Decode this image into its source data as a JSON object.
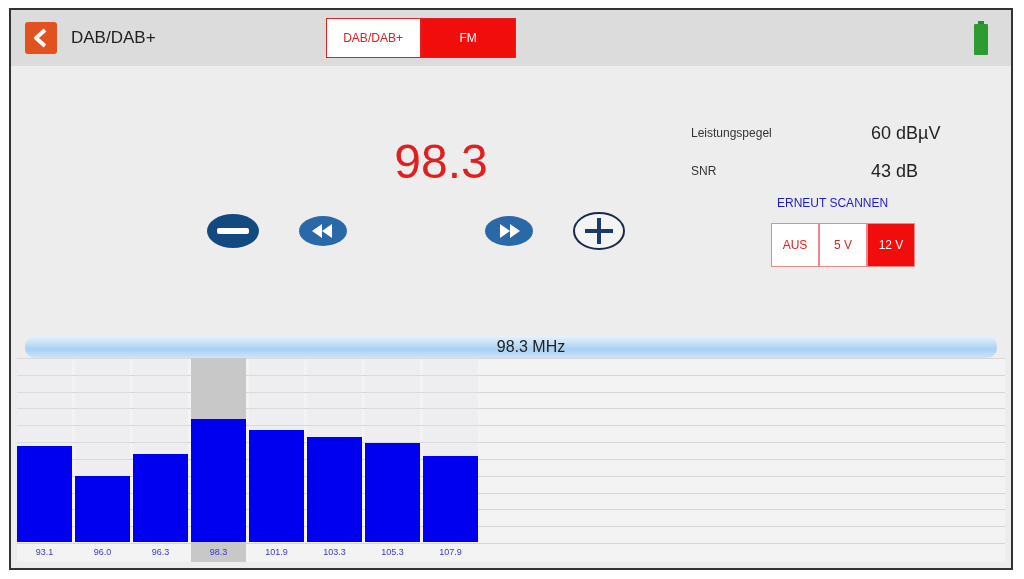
{
  "header": {
    "title": "DAB/DAB+"
  },
  "modes": [
    {
      "label": "DAB/DAB+",
      "selected": false
    },
    {
      "label": "FM",
      "selected": true
    }
  ],
  "frequency": "98.3",
  "readings": [
    {
      "label": "Leistungspegel",
      "value": "60 dBµV"
    },
    {
      "label": "SNR",
      "value": "43 dB"
    }
  ],
  "rescan": "ERNEUT SCANNEN",
  "voltages": [
    {
      "label": "AUS",
      "selected": false
    },
    {
      "label": "5 V",
      "selected": false
    },
    {
      "label": "12 V",
      "selected": true
    }
  ],
  "spectrum": {
    "title": "98.3 MHz",
    "stations": [
      {
        "label": "93.1",
        "level": 0.52,
        "selected": false
      },
      {
        "label": "96.0",
        "level": 0.36,
        "selected": false
      },
      {
        "label": "96.3",
        "level": 0.48,
        "selected": false
      },
      {
        "label": "98.3",
        "level": 0.67,
        "selected": true
      },
      {
        "label": "101.9",
        "level": 0.61,
        "selected": false
      },
      {
        "label": "103.3",
        "level": 0.57,
        "selected": false
      },
      {
        "label": "105.3",
        "level": 0.54,
        "selected": false
      },
      {
        "label": "107.9",
        "level": 0.47,
        "selected": false
      }
    ]
  }
}
